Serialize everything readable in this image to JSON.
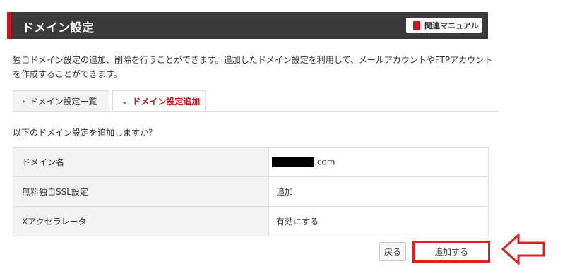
{
  "header": {
    "title": "ドメイン設定",
    "manual_label": "関連マニュアル"
  },
  "description": "独自ドメイン設定の追加、削除を行うことができます。追加したドメイン設定を利用して、メールアカウントやFTPアカウントを作成することができます。",
  "tabs": [
    {
      "label": "ドメイン設定一覧",
      "active": false
    },
    {
      "label": "ドメイン設定追加",
      "active": true
    }
  ],
  "confirm_text": "以下のドメイン設定を追加しますか？",
  "rows": [
    {
      "label": "ドメイン名",
      "value": ".com"
    },
    {
      "label": "無料独自SSL設定",
      "value": "追加"
    },
    {
      "label": "Xアクセラレータ",
      "value": "有効にする"
    }
  ],
  "buttons": {
    "back_label": "戻る",
    "add_label": "追加する"
  },
  "colors": {
    "accent": "#c4161c",
    "header_bg": "#3a3a3a",
    "highlight": "#e02020"
  }
}
